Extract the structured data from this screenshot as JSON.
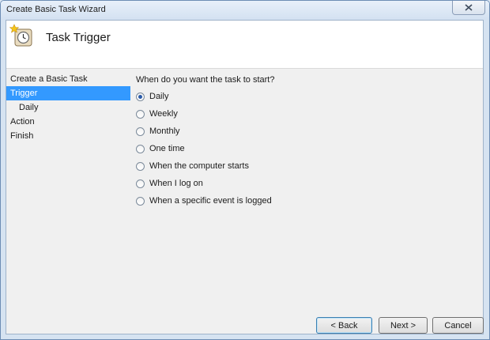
{
  "window": {
    "title": "Create Basic Task Wizard"
  },
  "header": {
    "title": "Task Trigger",
    "icon": "clock-star-icon"
  },
  "nav": {
    "items": [
      {
        "label": "Create a Basic Task",
        "active": false,
        "sub": false
      },
      {
        "label": "Trigger",
        "active": true,
        "sub": false
      },
      {
        "label": "Daily",
        "active": false,
        "sub": true
      },
      {
        "label": "Action",
        "active": false,
        "sub": false
      },
      {
        "label": "Finish",
        "active": false,
        "sub": false
      }
    ]
  },
  "main": {
    "question": "When do you want the task to start?",
    "options": [
      {
        "label": "Daily",
        "checked": true
      },
      {
        "label": "Weekly",
        "checked": false
      },
      {
        "label": "Monthly",
        "checked": false
      },
      {
        "label": "One time",
        "checked": false
      },
      {
        "label": "When the computer starts",
        "checked": false
      },
      {
        "label": "When I log on",
        "checked": false
      },
      {
        "label": "When a specific event is logged",
        "checked": false
      }
    ]
  },
  "buttons": {
    "back": "< Back",
    "next": "Next >",
    "cancel": "Cancel"
  },
  "colors": {
    "selection": "#3399ff",
    "accent": "#2a5aa8"
  }
}
